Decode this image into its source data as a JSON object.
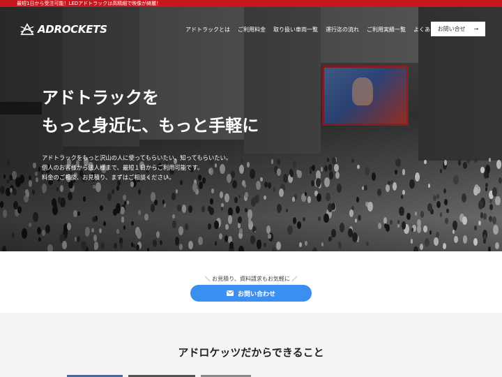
{
  "announcement": {
    "text": "最短1日から受注可能！LEDアドトラックは高精細で映像が綺麗！"
  },
  "header": {
    "logo_text": "ADROCKETS",
    "nav_items": [
      {
        "label": "アドトラックとは"
      },
      {
        "label": "ご利用料金"
      },
      {
        "label": "取り扱い車両一覧"
      },
      {
        "label": "運行迄の流れ"
      },
      {
        "label": "ご利用実績一覧"
      },
      {
        "label": "よくある質問"
      }
    ],
    "contact_button": {
      "label": "お問い合せ",
      "arrow": "→"
    }
  },
  "hero": {
    "title_lines": [
      "アドトラックを",
      "もっと身近に、もっと手軽に"
    ],
    "description_lines": [
      "アドトラックをもっと沢山の人に使ってもらいたい、知ってもらいたい。",
      "個人のお客様から法人様まで、最短１日からご利用可能です。",
      "料金のご相談、お見積り、まずはご相談ください。"
    ]
  },
  "cta": {
    "note": "＼ お見積り、資料請求もお気軽に ／",
    "button_label": "お問い合わせ",
    "button_icon": "mail-icon",
    "button_color": "#3b8ff0"
  },
  "features": {
    "title": "アドロケッツだからできること"
  },
  "colors": {
    "brand_red": "#c8161e",
    "accent_blue": "#3b8ff0"
  }
}
